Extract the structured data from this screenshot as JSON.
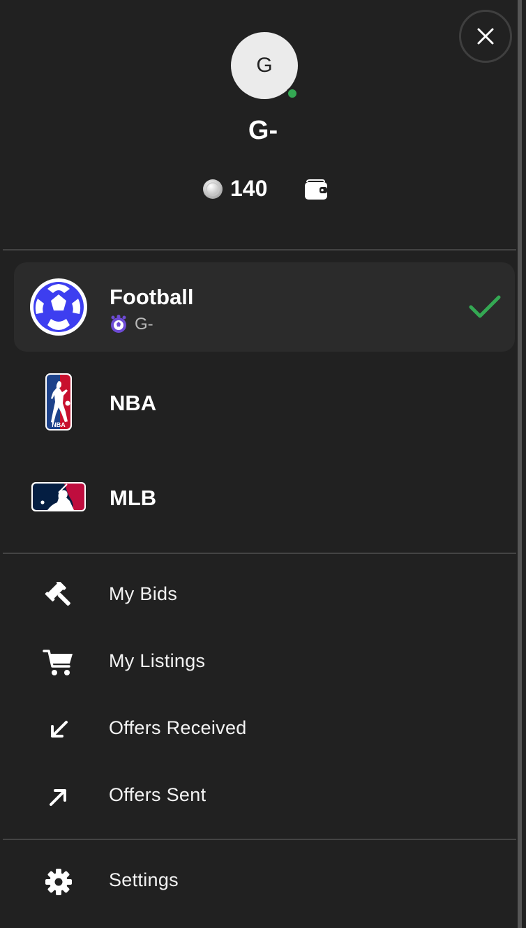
{
  "profile": {
    "avatar_initial": "G",
    "username": "G-",
    "status": "online",
    "coin_balance": "140"
  },
  "colors": {
    "background": "#212121",
    "selected_bg": "#2b2b2b",
    "accent_green": "#34a853",
    "divider": "#444444"
  },
  "sports": [
    {
      "name": "Football",
      "subtitle": "G-",
      "selected": true,
      "logo": "football-logo"
    },
    {
      "name": "NBA",
      "subtitle": "",
      "selected": false,
      "logo": "nba-logo"
    },
    {
      "name": "MLB",
      "subtitle": "",
      "selected": false,
      "logo": "mlb-logo"
    }
  ],
  "menu": {
    "bids": {
      "label": "My Bids",
      "icon": "gavel-icon"
    },
    "listings": {
      "label": "My Listings",
      "icon": "cart-icon"
    },
    "offers_received": {
      "label": "Offers Received",
      "icon": "arrow-down-left-icon"
    },
    "offers_sent": {
      "label": "Offers Sent",
      "icon": "arrow-up-right-icon"
    },
    "settings": {
      "label": "Settings",
      "icon": "gear-icon"
    }
  }
}
